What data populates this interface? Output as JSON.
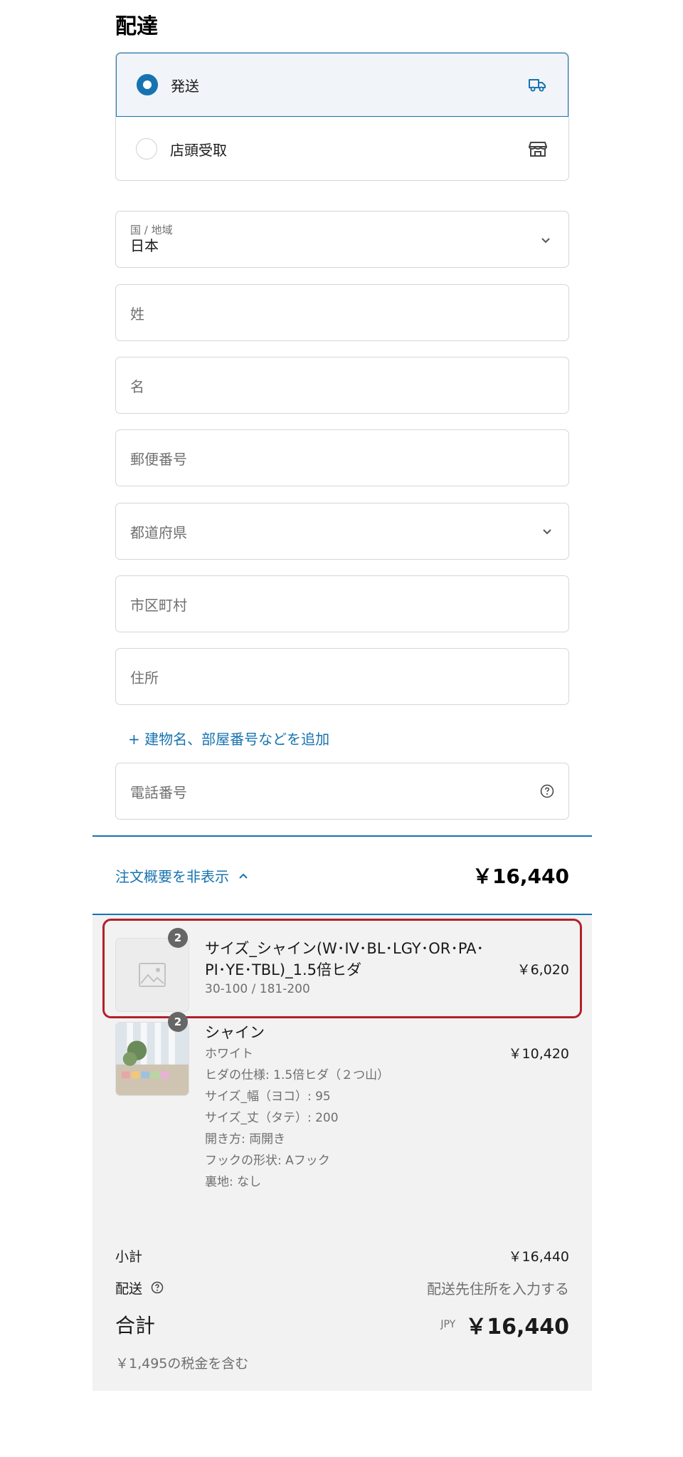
{
  "delivery": {
    "title": "配達",
    "methods": [
      {
        "label": "発送",
        "selected": true,
        "icon": "truck-icon"
      },
      {
        "label": "店頭受取",
        "selected": false,
        "icon": "store-icon"
      }
    ]
  },
  "form": {
    "country": {
      "label": "国 / 地域",
      "value": "日本"
    },
    "last_name": {
      "placeholder": "姓"
    },
    "first_name": {
      "placeholder": "名"
    },
    "postal_code": {
      "placeholder": "郵便番号"
    },
    "prefecture": {
      "placeholder": "都道府県"
    },
    "city": {
      "placeholder": "市区町村"
    },
    "address": {
      "placeholder": "住所"
    },
    "add_address_line": "+ 建物名、部屋番号などを追加",
    "phone": {
      "placeholder": "電話番号"
    }
  },
  "summary": {
    "toggle_label": "注文概要を非表示",
    "toggle_total": "￥16,440",
    "items": [
      {
        "quantity": "2",
        "name_line1": "サイズ_シャイン(W･IV･BL･LGY･OR･PA･",
        "name_line2": "PI･YE･TBL)_1.5倍ヒダ",
        "variant": "30-100 / 181-200",
        "price": "￥6,020"
      },
      {
        "quantity": "2",
        "name": "シャイン",
        "properties": [
          "ホワイト",
          "ヒダの仕様: 1.5倍ヒダ（２つ山）",
          "サイズ_幅（ヨコ）: 95",
          "サイズ_丈（タテ）: 200",
          "開き方: 両開き",
          "フックの形状: Aフック",
          "裏地: なし"
        ],
        "price": "￥10,420"
      }
    ],
    "subtotal_label": "小計",
    "subtotal_value": "￥16,440",
    "shipping_label": "配送",
    "shipping_value": "配送先住所を入力する",
    "total_label": "合計",
    "currency": "JPY",
    "total_value": "￥16,440",
    "tax_note": "￥1,495の税金を含む"
  },
  "colors": {
    "accent": "#1773b0",
    "highlight": "#b3202a"
  }
}
